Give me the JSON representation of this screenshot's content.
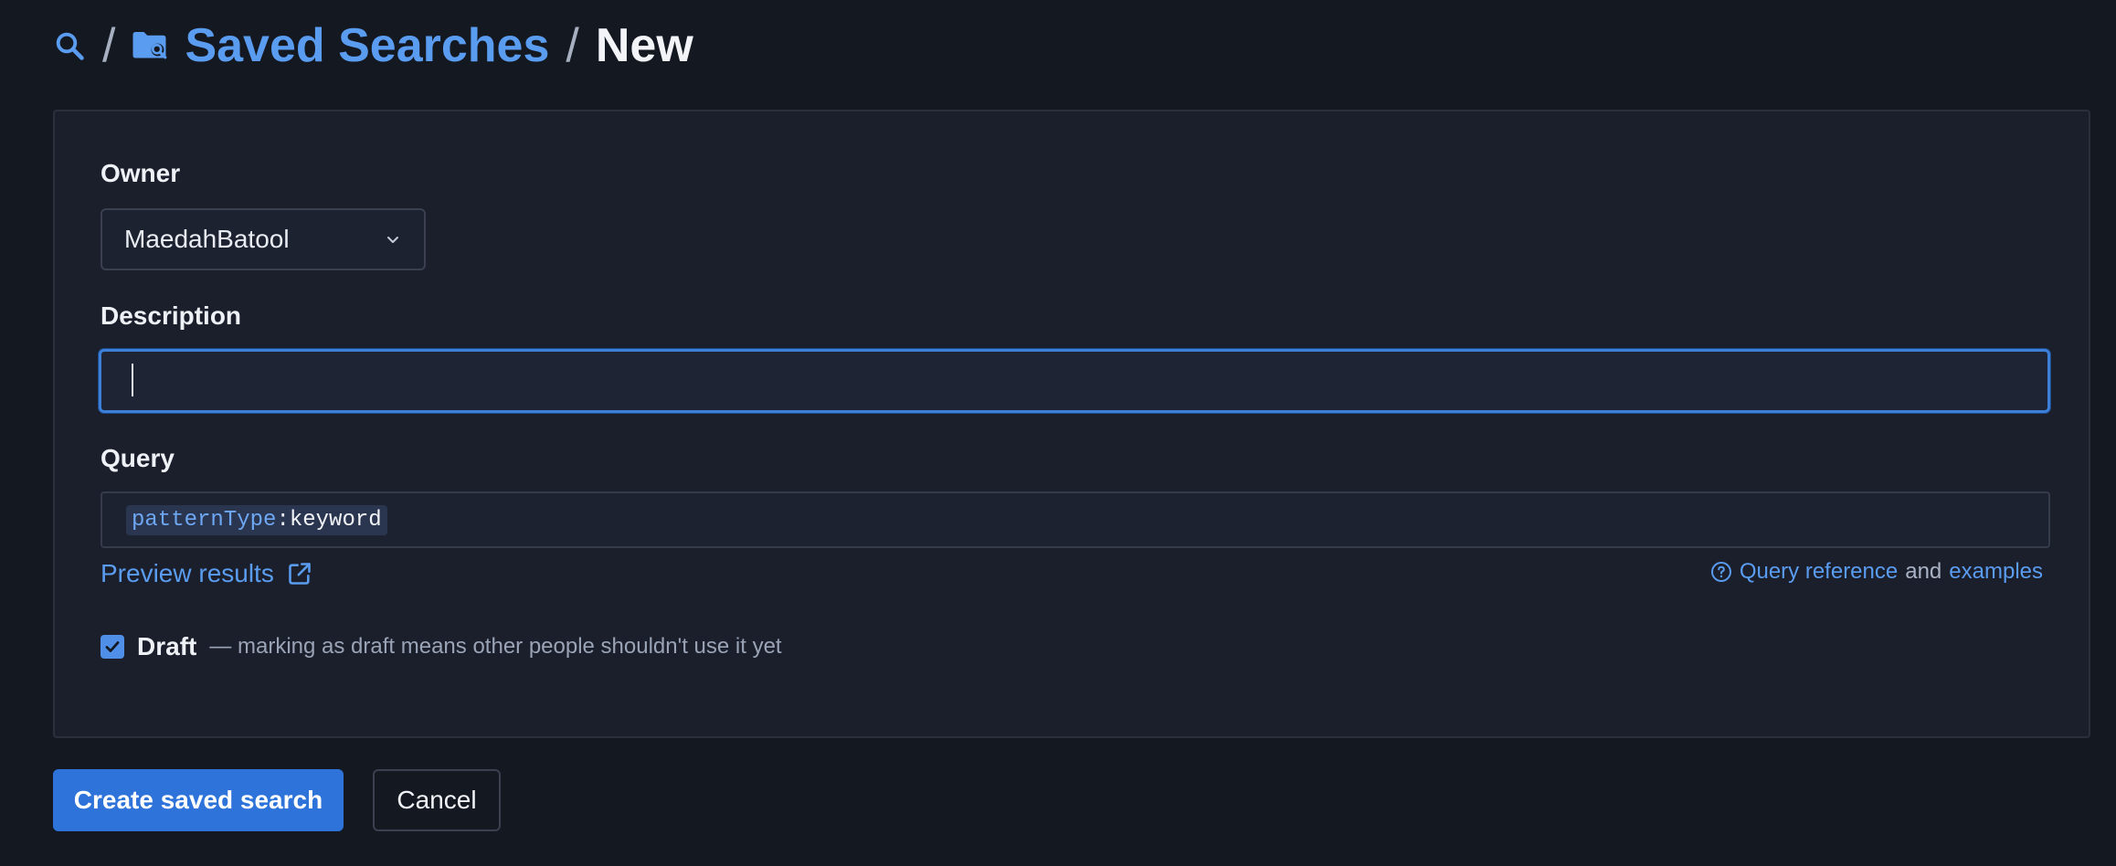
{
  "colors": {
    "background": "#141821",
    "panel": "#1b1f2b",
    "accent": "#2e73d9",
    "link": "#5a9cf0",
    "focus_ring": "#3c7fd9"
  },
  "breadcrumb": {
    "search_icon": "search-icon",
    "separator": "/",
    "folder_icon": "folder-search-icon",
    "section_label": "Saved Searches",
    "current_label": "New"
  },
  "form": {
    "owner": {
      "label": "Owner",
      "selected_value": "MaedahBatool",
      "chevron_icon": "chevron-down-icon"
    },
    "description": {
      "label": "Description",
      "value": "",
      "placeholder": ""
    },
    "query": {
      "label": "Query",
      "field": "patternType",
      "colon": ":",
      "value": "keyword"
    },
    "preview": {
      "label": "Preview results",
      "icon": "external-link-icon"
    },
    "reference": {
      "icon": "help-circle-icon",
      "link_label": "Query reference",
      "joiner": "and",
      "examples_label": "examples"
    },
    "draft": {
      "checked": true,
      "label": "Draft",
      "note": "— marking as draft means other people shouldn't use it yet"
    }
  },
  "actions": {
    "submit_label": "Create saved search",
    "cancel_label": "Cancel"
  }
}
